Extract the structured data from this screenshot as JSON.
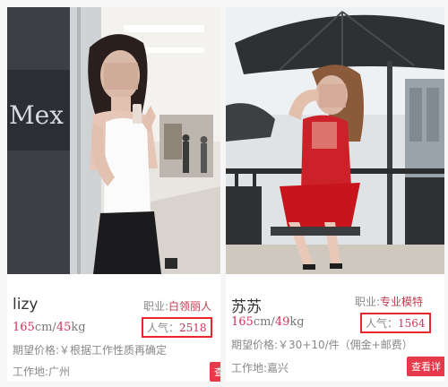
{
  "cards": [
    {
      "name": "lizy",
      "job_label": "职业:",
      "job_value": "白领丽人",
      "height_value": "165",
      "height_unit": "cm/",
      "weight_value": "45",
      "weight_unit": "kg",
      "popularity_label": "人气：",
      "popularity_value": "2518",
      "price": "期望价格:￥根据工作性质再确定",
      "location": "工作地:广州",
      "view_button": "查"
    },
    {
      "name": "苏苏",
      "job_label": "职业:",
      "job_value": "专业模特",
      "height_value": "165",
      "height_unit": "cm/",
      "weight_value": "49",
      "weight_unit": "kg",
      "popularity_label": "人气：",
      "popularity_value": "1564",
      "price": "期望价格:￥30+10/件（佣金+邮费）",
      "location": "工作地:嘉兴",
      "view_button": "查看详"
    }
  ],
  "photo_signs": {
    "mall_sign": "Mex"
  },
  "colors": {
    "accent": "#d0325a",
    "highlight_box": "#e8282b",
    "button": "#e43a4a"
  }
}
